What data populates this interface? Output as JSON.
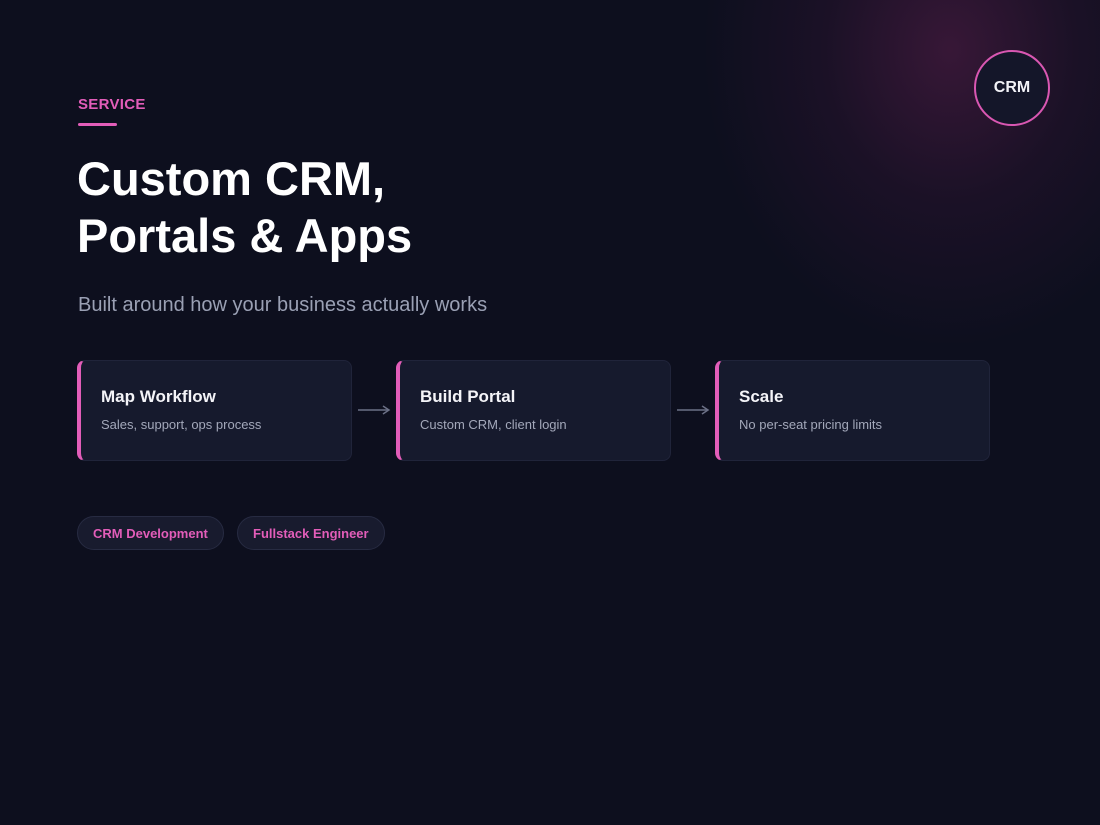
{
  "badge": {
    "label": "CRM"
  },
  "header": {
    "eyebrow": "SERVICE",
    "title_line1": "Custom CRM,",
    "title_line2": "Portals & Apps",
    "subtitle": "Built around how your business actually works"
  },
  "steps": [
    {
      "title": "Map Workflow",
      "description": "Sales, support, ops process"
    },
    {
      "title": "Build Portal",
      "description": "Custom CRM, client login"
    },
    {
      "title": "Scale",
      "description": "No per-seat pricing limits"
    }
  ],
  "tags": [
    "CRM Development",
    "Fullstack Engineer"
  ],
  "colors": {
    "background": "#0d0f1e",
    "accent": "#e25db9",
    "card": "#161a2d",
    "text_muted": "#9aa0b4"
  },
  "icons": [
    "arrow-right-icon"
  ]
}
